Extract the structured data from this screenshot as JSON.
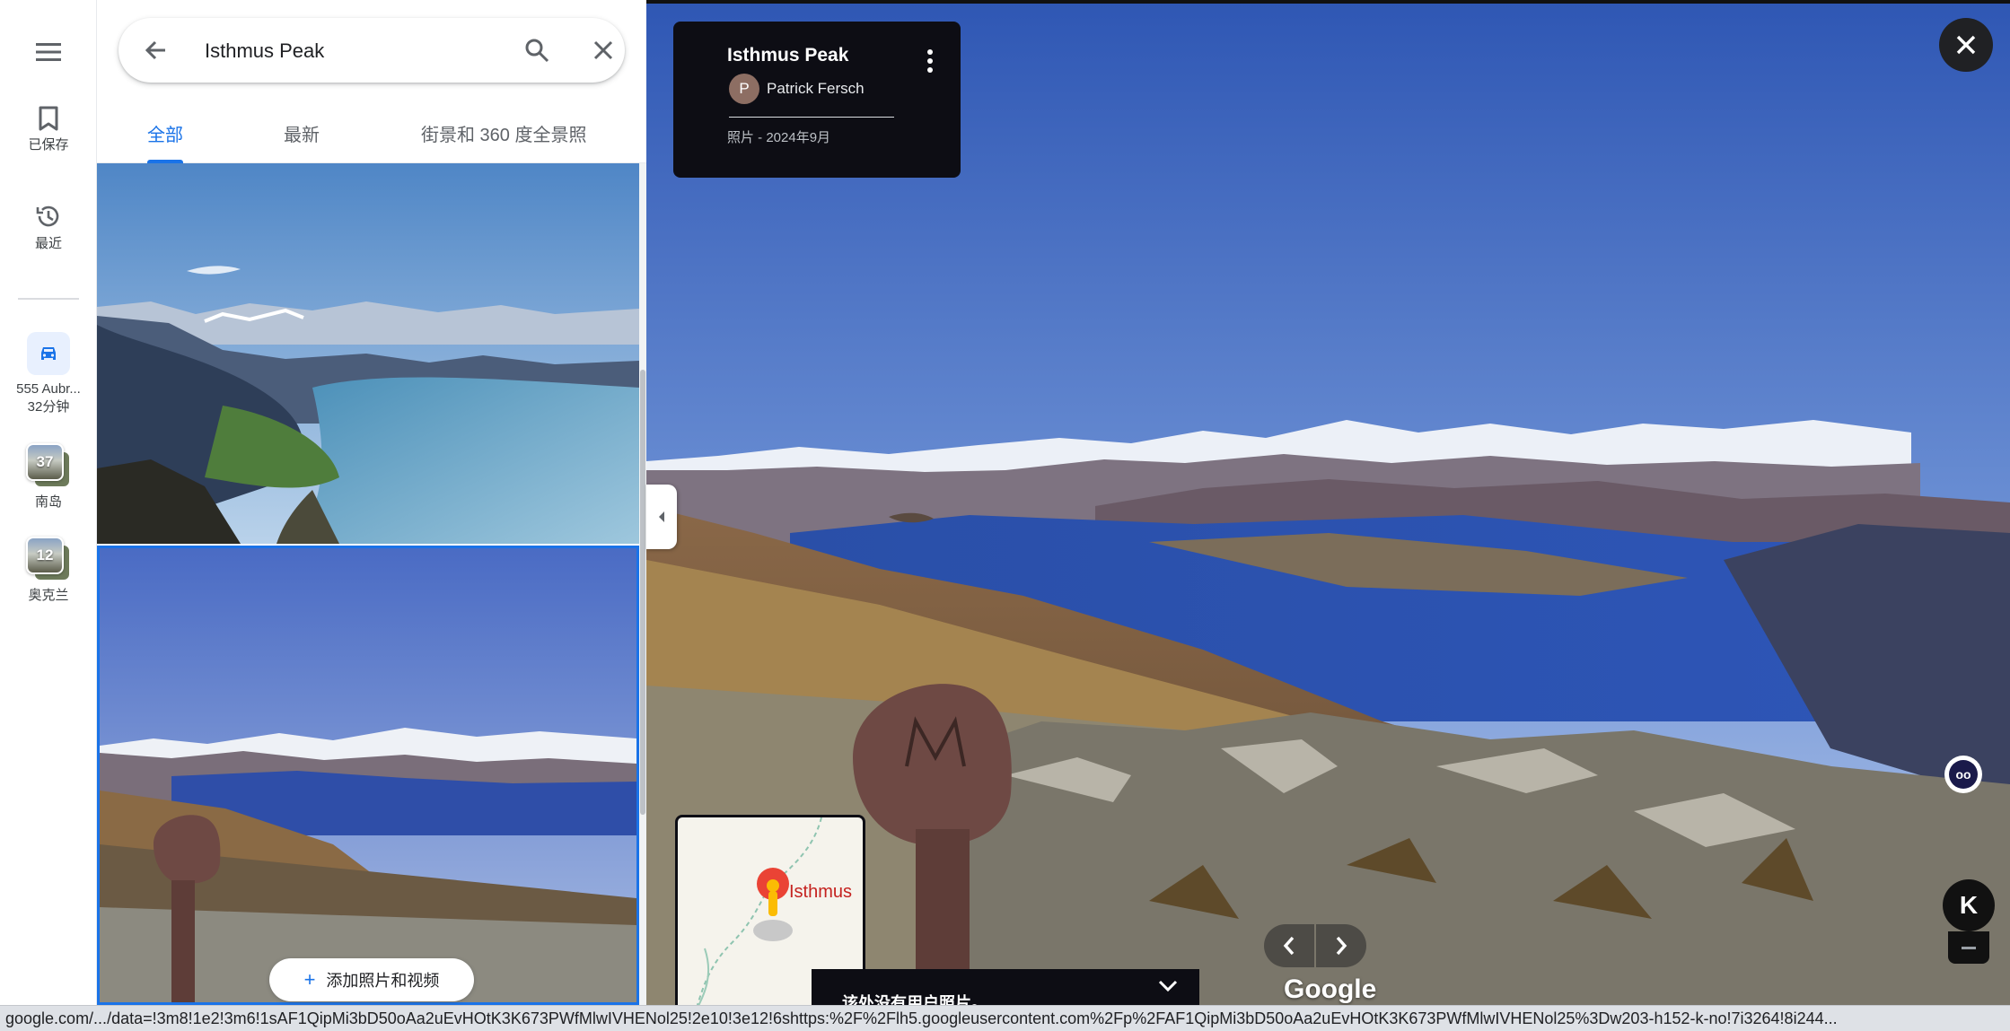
{
  "rail": {
    "saved_label": "已保存",
    "recent_label": "最近",
    "route": {
      "label": "555 Aubr...",
      "duration": "32分钟"
    },
    "lists": [
      {
        "count": "37",
        "label": "南岛"
      },
      {
        "count": "12",
        "label": "奥克兰"
      }
    ]
  },
  "search": {
    "query": "Isthmus Peak"
  },
  "tabs": [
    {
      "label": "全部",
      "active": true
    },
    {
      "label": "最新",
      "active": false
    },
    {
      "label": "街景和 360 度全景照",
      "active": false
    }
  ],
  "panel": {
    "add_photo_label": "添加照片和视频"
  },
  "viewer": {
    "place_title": "Isthmus Peak",
    "author_initial": "P",
    "author_name": "Patrick Fersch",
    "photo_meta": "照片 - 2024年9月",
    "minimap_label": "Isthmus",
    "no_photo_message": "该处没有用户照片。",
    "google_logo": "Google",
    "extension_letter": "K"
  },
  "statusbar": {
    "url": "google.com/.../data=!3m8!1e2!3m6!1sAF1QipMi3bD50oAa2uEvHOtK3K673PWfMlwIVHENol25!2e10!3e12!6shttps:%2F%2Flh5.googleusercontent.com%2Fp%2FAF1QipMi3bD50oAa2uEvHOtK3K673PWfMlwIVHENol25%3Dw203-h152-k-no!7i3264!8i244..."
  },
  "colors": {
    "accent": "#1a73e8",
    "viewer_card": "#0d0d14",
    "pin": "#ea4335"
  }
}
